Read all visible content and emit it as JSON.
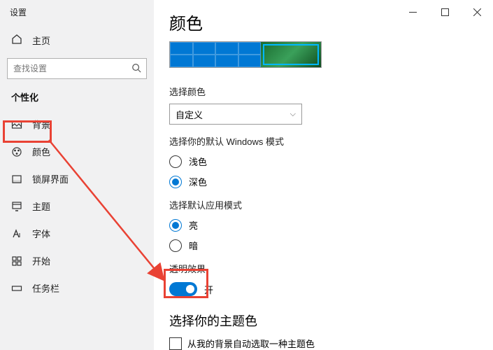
{
  "window": {
    "title": "设置"
  },
  "sidebar": {
    "home": "主页",
    "search_placeholder": "查找设置",
    "section": "个性化",
    "items": [
      {
        "label": "背景"
      },
      {
        "label": "颜色"
      },
      {
        "label": "锁屏界面"
      },
      {
        "label": "主题"
      },
      {
        "label": "字体"
      },
      {
        "label": "开始"
      },
      {
        "label": "任务栏"
      }
    ]
  },
  "page": {
    "title": "颜色",
    "choose_color_label": "选择颜色",
    "choose_color_value": "自定义",
    "windows_mode_label": "选择你的默认 Windows 模式",
    "windows_mode_light": "浅色",
    "windows_mode_dark": "深色",
    "app_mode_label": "选择默认应用模式",
    "app_mode_light": "亮",
    "app_mode_dark": "暗",
    "transparency_label": "透明效果",
    "transparency_state": "开",
    "accent_heading": "选择你的主题色",
    "accent_auto": "从我的背景自动选取一种主题色"
  },
  "annotations": {
    "highlight_sidebar_item": 1,
    "highlight_toggle": true
  }
}
